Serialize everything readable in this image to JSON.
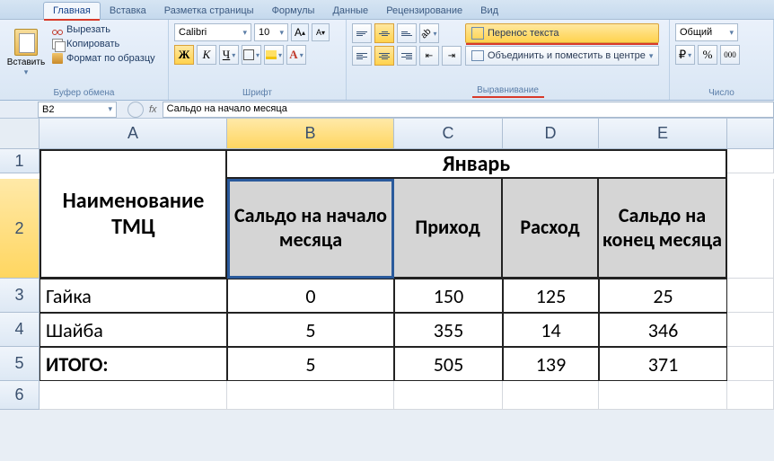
{
  "ribbon": {
    "tabs": [
      "Главная",
      "Вставка",
      "Разметка страницы",
      "Формулы",
      "Данные",
      "Рецензирование",
      "Вид"
    ],
    "clipboard": {
      "paste": "Вставить",
      "cut": "Вырезать",
      "copy": "Копировать",
      "format_painter": "Формат по образцу",
      "group": "Буфер обмена"
    },
    "font": {
      "name": "Calibri",
      "size": "10",
      "bold": "Ж",
      "italic": "К",
      "underline": "Ч",
      "inc": "A",
      "dec": "A",
      "group": "Шрифт"
    },
    "alignment": {
      "wrap": "Перенос текста",
      "merge": "Объединить и поместить в центре",
      "group": "Выравнивание"
    },
    "number": {
      "format": "Общий",
      "group": "Число"
    }
  },
  "namebox": "B2",
  "formula": "Сальдо на начало месяца",
  "columns": [
    "A",
    "B",
    "C",
    "D",
    "E"
  ],
  "rows": [
    "1",
    "2",
    "3",
    "4",
    "5",
    "6"
  ],
  "table": {
    "name_header": "Наименование ТМЦ",
    "month": "Январь",
    "sub": [
      "Сальдо на начало месяца",
      "Приход",
      "Расход",
      "Сальдо на конец месяца"
    ],
    "data": [
      {
        "name": "Гайка",
        "start": "0",
        "in": "150",
        "out": "125",
        "end": "25"
      },
      {
        "name": "Шайба",
        "start": "5",
        "in": "355",
        "out": "14",
        "end": "346"
      },
      {
        "name": "ИТОГО:",
        "start": "5",
        "in": "505",
        "out": "139",
        "end": "371"
      }
    ]
  },
  "chart_data": {
    "type": "table",
    "title": "Январь",
    "columns": [
      "Наименование ТМЦ",
      "Сальдо на начало месяца",
      "Приход",
      "Расход",
      "Сальдо на конец месяца"
    ],
    "rows": [
      [
        "Гайка",
        0,
        150,
        125,
        25
      ],
      [
        "Шайба",
        5,
        355,
        14,
        346
      ],
      [
        "ИТОГО:",
        5,
        505,
        139,
        371
      ]
    ]
  }
}
